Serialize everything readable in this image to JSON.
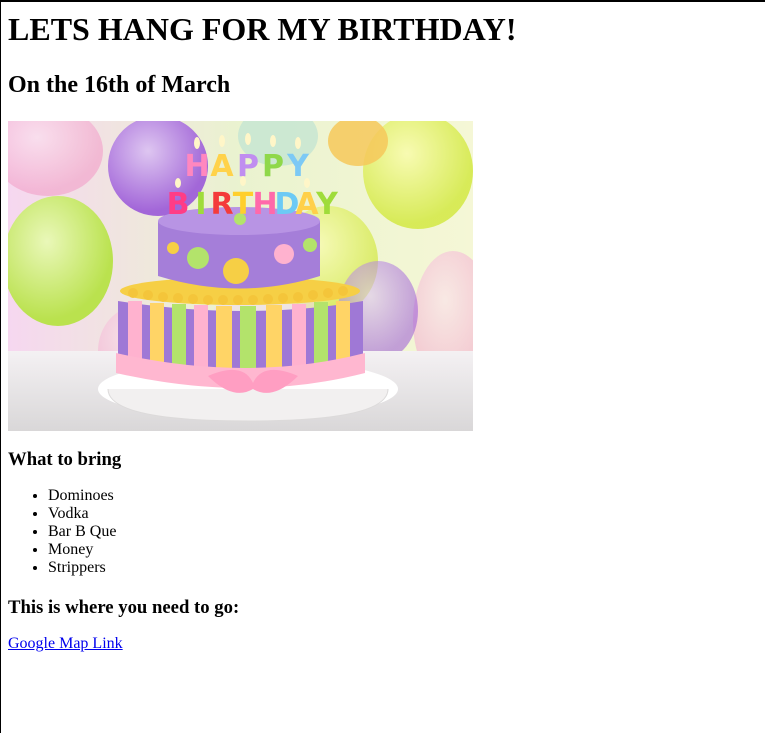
{
  "heading": "LETS HANG FOR MY BIRTHDAY!",
  "date": "On the 16th of March",
  "image": {
    "candle_letters_top": [
      "H",
      "A",
      "P",
      "P",
      "Y"
    ],
    "candle_letters_bottom": [
      "B",
      "I",
      "R",
      "T",
      "H",
      "D",
      "A",
      "Y"
    ]
  },
  "bring_heading": "What to bring",
  "bring_items": [
    "Dominoes",
    "Vodka",
    "Bar B Que",
    "Money",
    "Strippers"
  ],
  "where_heading": "This is where you need to go:",
  "map_link": "Google Map Link",
  "colors": {
    "link": "#0000ee",
    "text": "#000000"
  }
}
